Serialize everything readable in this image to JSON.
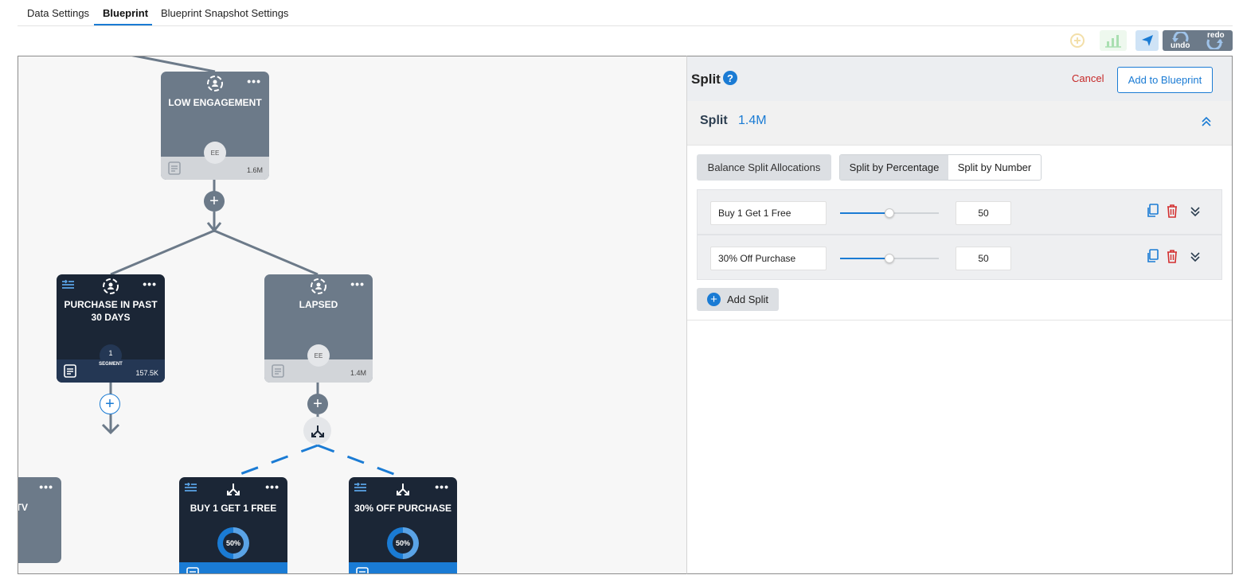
{
  "tabs": [
    {
      "label": "Data Settings"
    },
    {
      "label": "Blueprint"
    },
    {
      "label": "Blueprint Snapshot Settings"
    }
  ],
  "toolbar": {
    "undo_label": "undo",
    "redo_label": "redo",
    "icons": [
      "add-circle-icon",
      "bar-chart-icon",
      "send-icon",
      "undo-icon",
      "redo-icon"
    ]
  },
  "nodes": {
    "low_engagement": {
      "title": "LOW ENGAGEMENT",
      "badge": "EE",
      "count": "1.6M"
    },
    "purchase_30": {
      "title": "PURCHASE IN PAST 30 DAYS",
      "segment_count": "1",
      "segment_label": "SEGMENT",
      "count": "157.5K"
    },
    "lapsed": {
      "title": "LAPSED",
      "badge": "EE",
      "count": "1.4M"
    },
    "partial_left": {
      "title": "TV"
    },
    "buy1get1": {
      "title": "BUY 1 GET 1 FREE",
      "percent": "50%"
    },
    "off30": {
      "title": "30% OFF PURCHASE",
      "percent": "50%"
    }
  },
  "panel": {
    "title": "Split",
    "cancel_label": "Cancel",
    "add_label": "Add to Blueprint",
    "section_title": "Split",
    "section_count": "1.4M",
    "balance_label": "Balance Split Allocations",
    "by_percentage_label": "Split by Percentage",
    "by_number_label": "Split by Number",
    "splits": [
      {
        "name": "Buy 1 Get 1 Free",
        "value": "50",
        "slider_fraction": 0.5
      },
      {
        "name": "30% Off Purchase",
        "value": "50",
        "slider_fraction": 0.5
      }
    ],
    "add_split_label": "Add Split"
  },
  "colors": {
    "accent": "#1a7bd4",
    "node_gray": "#6c7a89",
    "node_dark": "#1b2636",
    "cancel": "#c62828"
  }
}
